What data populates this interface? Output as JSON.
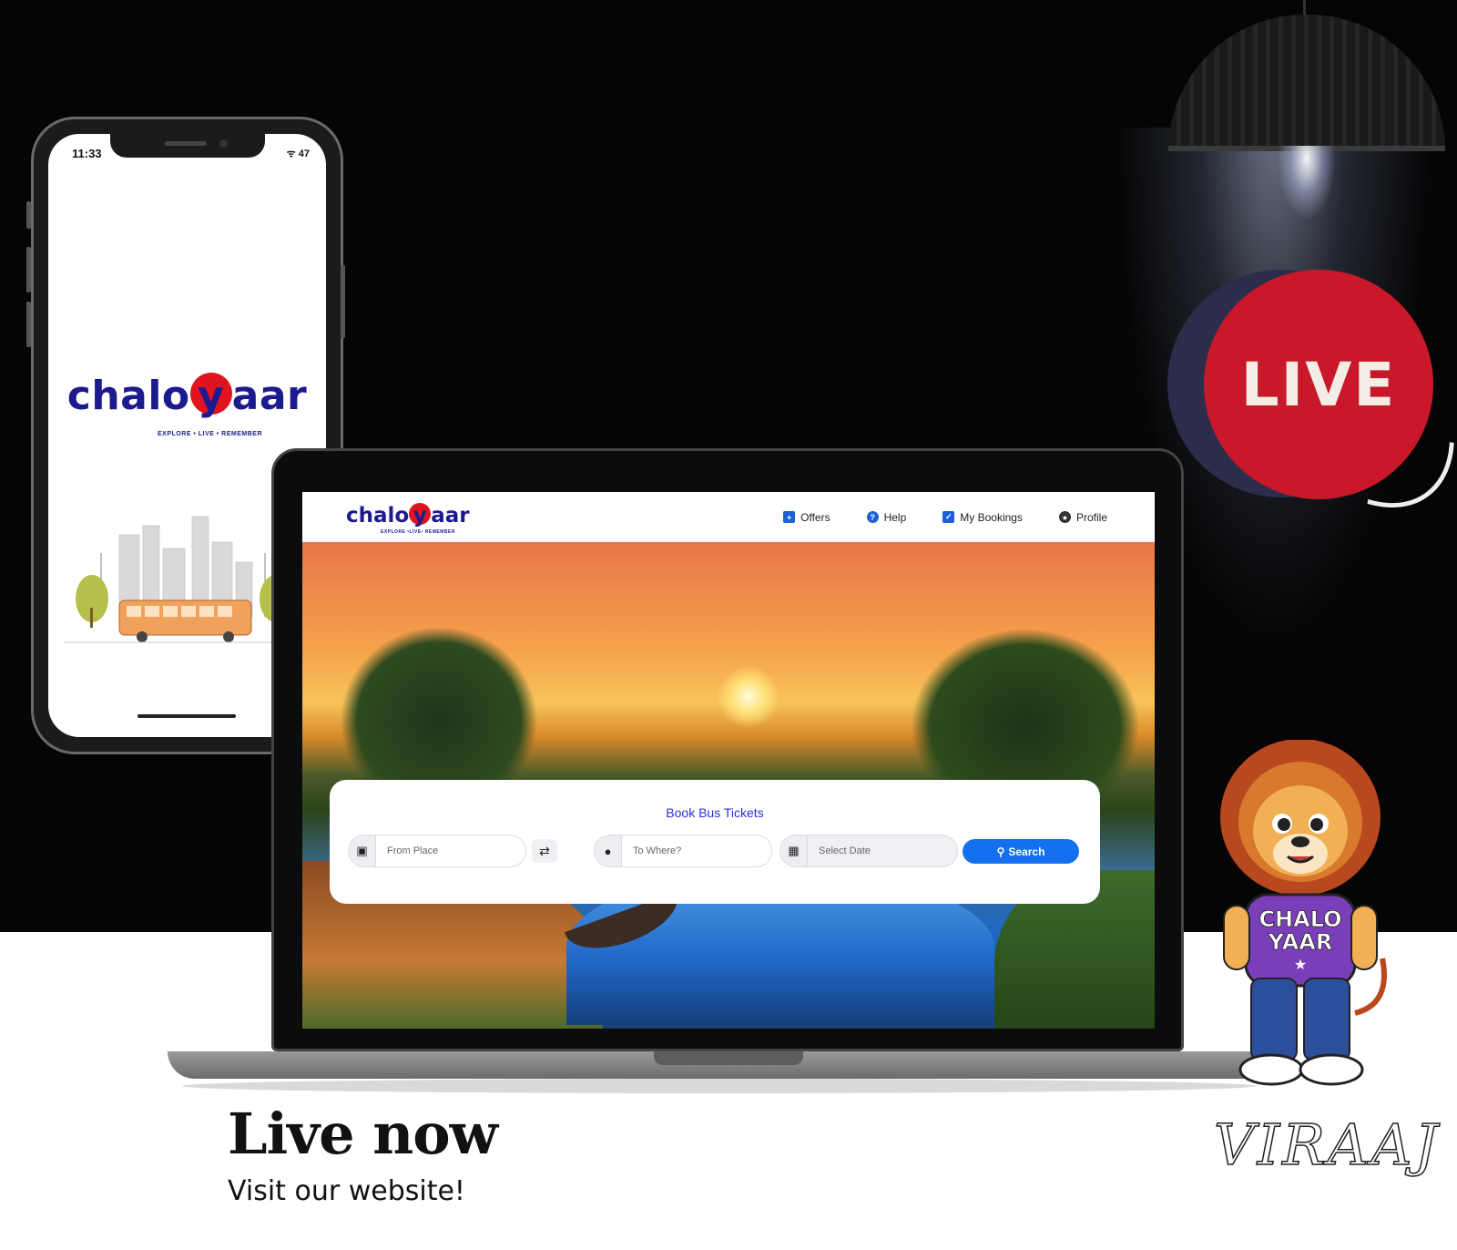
{
  "phone": {
    "status_time": "11:33",
    "status_icons": "ᯤ 47",
    "logo_pre": "chalo",
    "logo_y": "y",
    "logo_post": "aar",
    "tagline": "EXPLORE • LIVE • REMEMBER"
  },
  "website": {
    "logo_pre": "chalo",
    "logo_y": "y",
    "logo_post": "aar",
    "tagline": "EXPLORE •LIVE• REMEMBER",
    "nav": {
      "offers": "Offers",
      "help": "Help",
      "my_bookings": "My Bookings",
      "profile": "Profile"
    },
    "search_card": {
      "title": "Book Bus Tickets",
      "from_placeholder": "From Place",
      "to_placeholder": "To Where?",
      "date_placeholder": "Select Date",
      "search_button": "Search"
    }
  },
  "live_badge": "LIVE",
  "headline": "Live now",
  "subline": "Visit our website!",
  "mascot": {
    "shirt_line1": "CHALO",
    "shirt_line2": "YAAR",
    "signature": "VIRAAJ"
  },
  "colors": {
    "brand_blue": "#1c1a8f",
    "brand_red": "#e0141e",
    "live_red": "#c8182a",
    "search_blue": "#1570ef"
  }
}
